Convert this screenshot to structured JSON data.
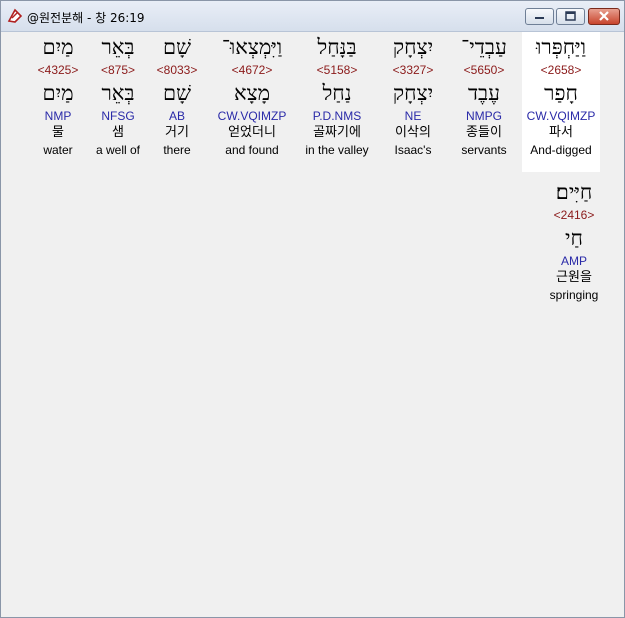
{
  "window": {
    "title": "@원전분해 - 창 26:19"
  },
  "words": [
    {
      "hebrew": "וַיַּחְפְּרוּ",
      "strong": "<2658>",
      "lemma": "חָפַר",
      "parsing": "CW.VQIMZP",
      "korean": "파서",
      "english": "And-digged"
    },
    {
      "hebrew": "עַבְדֵי־",
      "strong": "<5650>",
      "lemma": "עֶבֶד",
      "parsing": "NMPG",
      "korean": "종들이",
      "english": "servants"
    },
    {
      "hebrew": "יִצְחָק",
      "strong": "<3327>",
      "lemma": "יִצְחָק",
      "parsing": "NE",
      "korean": "이삭의",
      "english": "Isaac's"
    },
    {
      "hebrew": "בַּנָּחַל",
      "strong": "<5158>",
      "lemma": "נַחַל",
      "parsing": "P.D.NMS",
      "korean": "골짜기에",
      "english": "in the valley"
    },
    {
      "hebrew": "וַיִּמְצְאוּ־",
      "strong": "<4672>",
      "lemma": "מָצָא",
      "parsing": "CW.VQIMZP",
      "korean": "얻었더니",
      "english": "and found"
    },
    {
      "hebrew": "שָׁם",
      "strong": "<8033>",
      "lemma": "שָׁם",
      "parsing": "AB",
      "korean": "거기",
      "english": "there"
    },
    {
      "hebrew": "בְּאֵר",
      "strong": "<875>",
      "lemma": "בְּאֵר",
      "parsing": "NFSG",
      "korean": "샘",
      "english": "a well of"
    },
    {
      "hebrew": "מַיִם",
      "strong": "<4325>",
      "lemma": "מַיִם",
      "parsing": "NMP",
      "korean": "물",
      "english": "water"
    },
    {
      "hebrew": "חַיִּים׃",
      "strong": "<2416>",
      "lemma": "חַי",
      "parsing": "AMP",
      "korean": "근원을",
      "english": "springing"
    }
  ]
}
